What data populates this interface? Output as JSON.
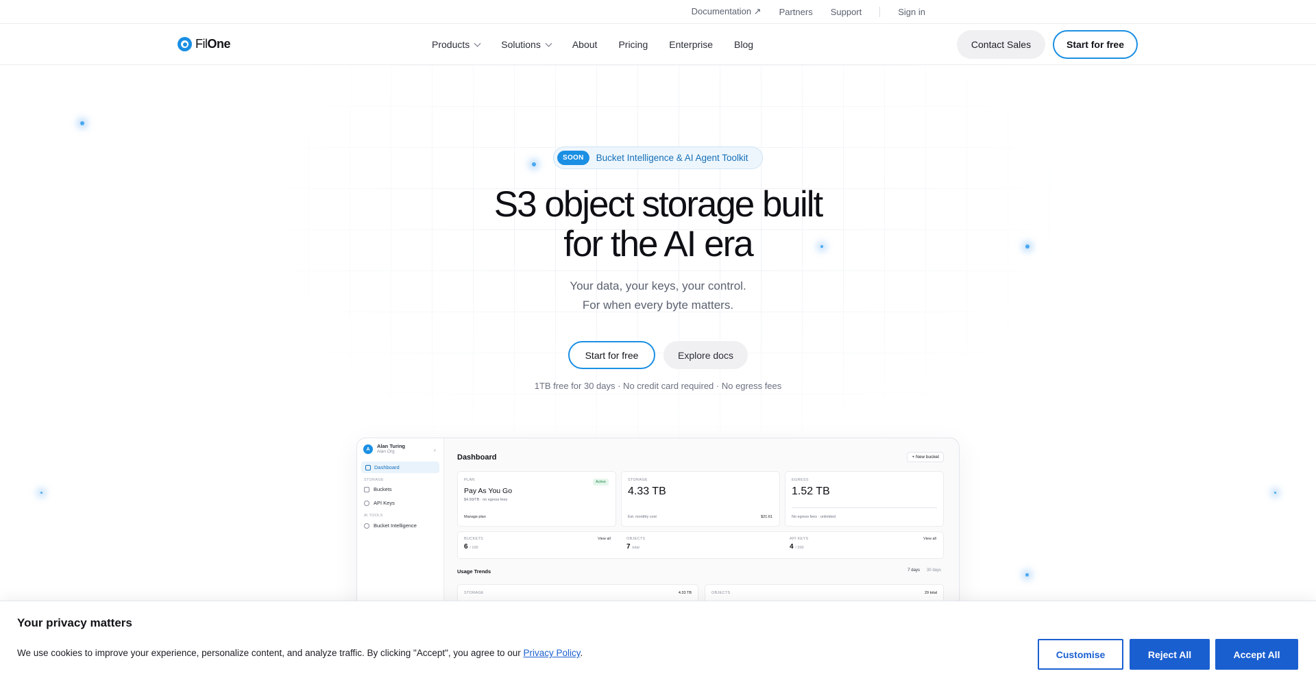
{
  "utility_nav": {
    "documentation": "Documentation ↗",
    "partners": "Partners",
    "support": "Support",
    "sign_in": "Sign in"
  },
  "brand": {
    "part1": "Fil",
    "part2": "One"
  },
  "nav": {
    "products": "Products",
    "solutions": "Solutions",
    "about": "About",
    "pricing": "Pricing",
    "enterprise": "Enterprise",
    "blog": "Blog",
    "contact_sales": "Contact Sales",
    "start_free": "Start for free"
  },
  "hero": {
    "badge_tag": "SOON",
    "badge_text": "Bucket Intelligence & AI Agent Toolkit",
    "title_line1": "S3 object storage built",
    "title_line2": "for the AI era",
    "subtitle_line1": "Your data, your keys, your control.",
    "subtitle_line2": "For when every byte matters.",
    "cta_primary": "Start for free",
    "cta_secondary": "Explore docs",
    "note": "1TB free for 30 days · No credit card required · No egress fees"
  },
  "dashboard": {
    "user_initial": "A",
    "user_name": "Alan Turing",
    "user_org": "Alan Org",
    "nav_dashboard": "Dashboard",
    "section_storage": "STORAGE",
    "nav_buckets": "Buckets",
    "nav_api_keys": "API Keys",
    "section_ai": "AI TOOLS",
    "nav_bucket_intel": "Bucket Intelligence",
    "title": "Dashboard",
    "new_bucket": "+ New bucket",
    "plan": {
      "label": "PLAN",
      "name": "Pay As You Go",
      "detail": "$4.99/TB · no egress fees",
      "status": "Active",
      "link": "Manage plan"
    },
    "storage": {
      "label": "STORAGE",
      "value": "4.33 TB",
      "est_label": "Est. monthly cost",
      "est_value": "$21.61"
    },
    "egress": {
      "label": "EGRESS",
      "value": "1.52 TB",
      "note": "No egress fees · unlimited"
    },
    "buckets": {
      "label": "BUCKETS",
      "value": "6",
      "of": "/ 100",
      "link": "View all"
    },
    "objects": {
      "label": "OBJECTS",
      "value": "7",
      "of": "total"
    },
    "api_keys": {
      "label": "API KEYS",
      "value": "4",
      "of": "/ 200",
      "link": "View all"
    },
    "trends_title": "Usage Trends",
    "range_7": "7 days",
    "range_30": "30 days",
    "trend_storage_label": "STORAGE",
    "trend_storage_value": "4.33 TB",
    "trend_objects_label": "OBJECTS",
    "trend_objects_value": "29 total"
  },
  "cookie": {
    "title": "Your privacy matters",
    "text": "We use cookies to improve your experience, personalize content, and analyze traffic. By clicking \"Accept\", you agree to our ",
    "link": "Privacy Policy",
    "end": ".",
    "customise": "Customise",
    "reject": "Reject All",
    "accept": "Accept All"
  },
  "colors": {
    "accent": "#1a8fe3",
    "cookie_button": "#1a5fd0"
  }
}
